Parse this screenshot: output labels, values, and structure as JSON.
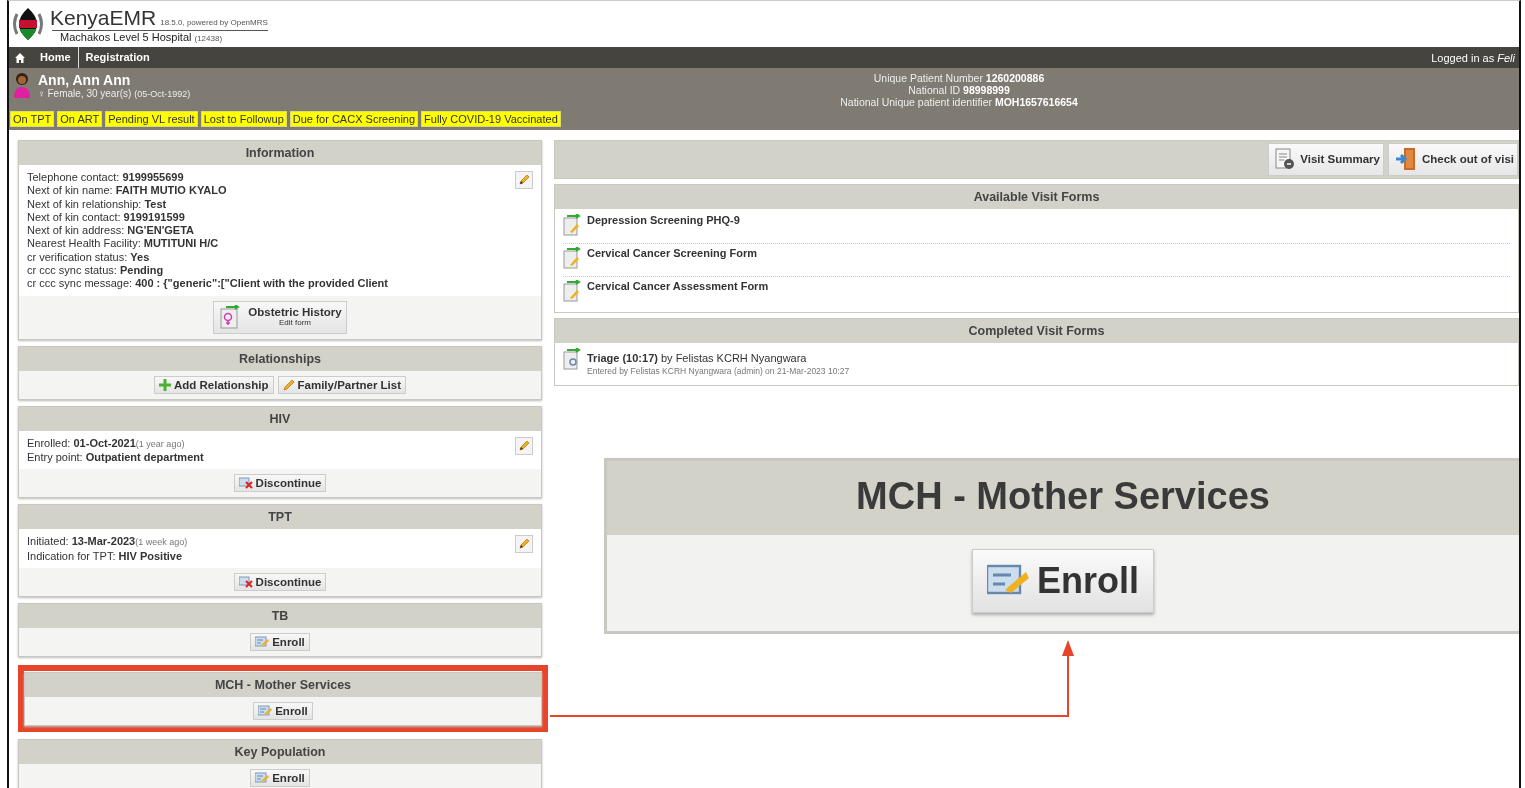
{
  "header": {
    "app_name": "KenyaEMR",
    "version": "18.5.0, powered by OpenMRS",
    "facility": "Machakos Level 5 Hospital",
    "facility_code": "(12438)"
  },
  "nav": {
    "items": [
      {
        "label": "Home",
        "kind": "home"
      },
      {
        "label": "Registration",
        "kind": "plain"
      }
    ],
    "logged_in": "Logged in as *Feli*"
  },
  "patient": {
    "name": "Ann, Ann Ann",
    "sex_symbol": "♀",
    "sex_age": "Female, 30 year(s)",
    "dob": "(05-Oct-1992)",
    "identifiers": [
      {
        "label": "Unique Patient Number",
        "value": "1260200886"
      },
      {
        "label": "National ID",
        "value": "98998999"
      },
      {
        "label": "National Unique patient identifier",
        "value": "MOH1657616654"
      }
    ],
    "flags": [
      "On TPT",
      "On ART",
      "Pending VL result",
      "Lost to Followup",
      "Due for CACX Screening",
      "Fully COVID-19 Vaccinated"
    ]
  },
  "panels": [
    {
      "title": "Information",
      "editable": true,
      "lines": [
        {
          "text": "Telephone contact: **9199955699**"
        },
        {
          "text": "Next of kin name: **FAITH MUTIO KYALO**"
        },
        {
          "text": "Next of kin relationship: **Test**"
        },
        {
          "text": "Next of kin contact: **9199191599**"
        },
        {
          "text": "Next of kin address: **NG'EN'GETA**"
        },
        {
          "text": "Nearest Health Facility: **MUTITUNI H/C**"
        },
        {
          "text": "cr verification status: **Yes**"
        },
        {
          "text": "cr ccc sync status: **Pending**"
        },
        {
          "text": "cr ccc sync message: **400 : {\"generic\":[\"Client with the provided Client**"
        }
      ],
      "actions": [
        {
          "kind": "form",
          "label": "Obstetric History",
          "sublabel": "Edit form"
        }
      ]
    },
    {
      "title": "Relationships",
      "actions": [
        {
          "kind": "add",
          "label": "Add Relationship"
        },
        {
          "kind": "edit",
          "label": "Family/Partner List"
        }
      ]
    },
    {
      "title": "HIV",
      "editable": true,
      "lines": [
        {
          "text": "Enrolled: **01-Oct-2021**",
          "note": "(1 year ago)"
        },
        {
          "text": "Entry point: **Outpatient department**"
        }
      ],
      "actions": [
        {
          "kind": "discontinue",
          "label": "Discontinue"
        }
      ]
    },
    {
      "title": "TPT",
      "editable": true,
      "lines": [
        {
          "text": "Initiated: **13-Mar-2023**",
          "note": "(1 week ago)"
        },
        {
          "text": "Indication for TPT: **HIV Positive**"
        }
      ],
      "actions": [
        {
          "kind": "discontinue",
          "label": "Discontinue"
        }
      ]
    },
    {
      "title": "TB",
      "actions": [
        {
          "kind": "enroll",
          "label": "Enroll"
        }
      ]
    },
    {
      "title": "MCH - Mother Services",
      "highlighted": true,
      "actions": [
        {
          "kind": "enroll",
          "label": "Enroll"
        }
      ]
    },
    {
      "title": "Key Population",
      "actions": [
        {
          "kind": "enroll",
          "label": "Enroll"
        }
      ]
    }
  ],
  "visit": {
    "toolbar": [
      {
        "kind": "summary",
        "label": "Visit Summary"
      },
      {
        "kind": "checkout",
        "label": "Check out of visi"
      }
    ],
    "available_title": "Available Visit Forms",
    "available_forms": [
      "Depression Screening PHQ-9",
      "Cervical Cancer Screening Form",
      "Cervical Cancer Assessment Form"
    ],
    "completed_title": "Completed Visit Forms",
    "completed_forms": [
      {
        "title": "**Triage (10:17)** by Felistas KCRH Nyangwara",
        "entered": "Entered by Felistas KCRH Nyangwara (admin) on 21-Mar-2023 10:27"
      }
    ]
  },
  "callout": {
    "title": "MCH - Mother Services",
    "button": "Enroll"
  }
}
